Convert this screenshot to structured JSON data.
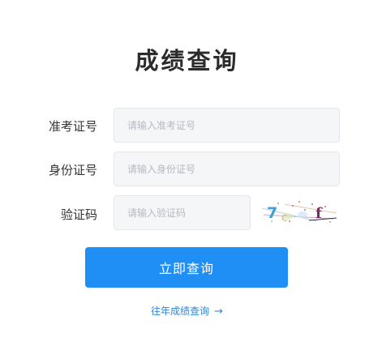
{
  "page": {
    "title": "成绩查询"
  },
  "form": {
    "exam_id": {
      "label": "准考证号",
      "placeholder": "请输入准考证号",
      "value": ""
    },
    "id_number": {
      "label": "身份证号",
      "placeholder": "请输入身份证号",
      "value": ""
    },
    "captcha": {
      "label": "验证码",
      "placeholder": "请输入验证码",
      "value": "",
      "image_text": "7c f"
    }
  },
  "actions": {
    "submit_label": "立即查询",
    "history_label": "往年成绩查询",
    "history_arrow": "→"
  },
  "colors": {
    "primary": "#1f8ef5",
    "link": "#2f86d6",
    "title": "#2c2c2c",
    "field_bg": "#f5f6f8",
    "field_border": "#e4e6eb"
  }
}
